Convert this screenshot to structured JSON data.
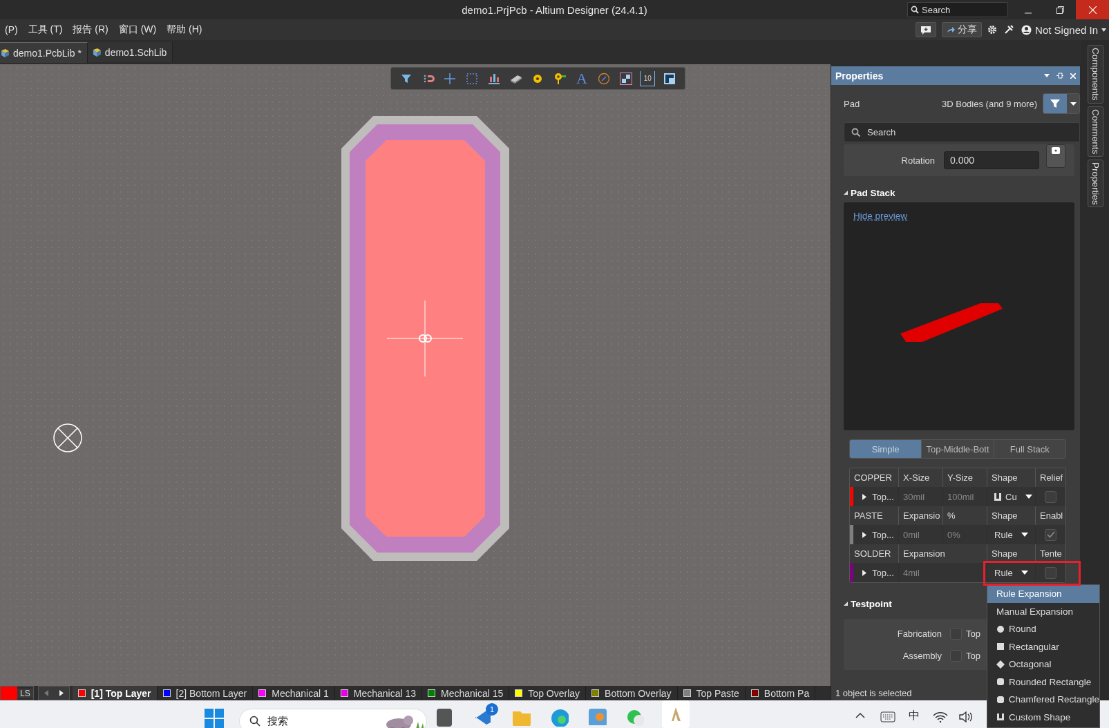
{
  "window": {
    "title": "demo1.PrjPcb - Altium Designer (24.4.1)",
    "search_placeholder": "Search"
  },
  "menu": [
    "(P)",
    "工具 (T)",
    "报告 (R)",
    "窗口 (W)",
    "帮助 (H)"
  ],
  "header_actions": {
    "share": "分享",
    "account": "Not Signed In"
  },
  "document_tabs": [
    {
      "label": "demo1.PcbLib *",
      "selected": true
    },
    {
      "label": "demo1.SchLib",
      "selected": false
    }
  ],
  "canvas_toolbar": [
    {
      "kind": "filter"
    },
    {
      "kind": "magnet"
    },
    {
      "kind": "cross"
    },
    {
      "kind": "select"
    },
    {
      "kind": "align"
    },
    {
      "kind": "chip"
    },
    {
      "kind": "pad"
    },
    {
      "kind": "via"
    },
    {
      "kind": "text",
      "glyph": "A"
    },
    {
      "kind": "arc"
    },
    {
      "kind": "fill"
    },
    {
      "kind": "port",
      "glyph": "10"
    },
    {
      "kind": "region"
    }
  ],
  "properties": {
    "title": "Properties",
    "object_type": "Pad",
    "filter_label": "3D Bodies (and 9 more)",
    "search_placeholder": "Search",
    "rotation": {
      "label": "Rotation",
      "value": "0.000"
    },
    "pad_stack": {
      "title": "Pad Stack",
      "preview_link": "Hide preview",
      "modes": [
        {
          "label": "Simple",
          "selected": true
        },
        {
          "label": "Top-Middle-Bott",
          "selected": false
        },
        {
          "label": "Full Stack",
          "selected": false
        }
      ],
      "groups": [
        {
          "columns": [
            "COPPER",
            "X-Size",
            "Y-Size",
            "Shape",
            "Relief"
          ],
          "row": {
            "layer": "Top...",
            "color": "#ff0000",
            "values": [
              "30mil",
              "100mil"
            ],
            "shape": "Cu",
            "kind": "custom",
            "checked": false,
            "highlighted": false
          }
        },
        {
          "columns": [
            "PASTE",
            "Expansio",
            "%",
            "Shape",
            "Enabl"
          ],
          "row": {
            "layer": "Top...",
            "color": "#808080",
            "values": [
              "0mil",
              "0%"
            ],
            "shape": "Rule",
            "kind": "rule",
            "checked": true,
            "highlighted": false
          }
        },
        {
          "columns": [
            "SOLDER",
            "Expansion",
            "Shape",
            "Tente"
          ],
          "row": {
            "layer": "Top...",
            "color": "#800080",
            "values": [
              "4mil"
            ],
            "shape": "Rule",
            "kind": "rule",
            "checked": false,
            "highlighted": true
          }
        }
      ]
    },
    "testpoint": {
      "title": "Testpoint",
      "items": [
        {
          "label": "Fabrication",
          "option": "Top",
          "checked": false
        },
        {
          "label": "Assembly",
          "option": "Top",
          "checked": false
        }
      ]
    },
    "status": "1 object is selected"
  },
  "side_tabs": [
    "Components",
    "Comments",
    "Properties"
  ],
  "layer_bar": {
    "mode": "LS",
    "layers": [
      {
        "name": "[1] Top Layer",
        "color": "#ff0000",
        "selected": true
      },
      {
        "name": "[2] Bottom Layer",
        "color": "#0000ff",
        "selected": false
      },
      {
        "name": "Mechanical 1",
        "color": "#ff00ff",
        "selected": false
      },
      {
        "name": "Mechanical 13",
        "color": "#e600e6",
        "selected": false
      },
      {
        "name": "Mechanical 15",
        "color": "#008000",
        "selected": false
      },
      {
        "name": "Top Overlay",
        "color": "#ffff00",
        "selected": false
      },
      {
        "name": "Bottom Overlay",
        "color": "#808000",
        "selected": false
      },
      {
        "name": "Top Paste",
        "color": "#808080",
        "selected": false
      },
      {
        "name": "Bottom Pa",
        "color": "#800000",
        "selected": false
      }
    ]
  },
  "shape_dropdown": [
    {
      "label": "Rule Expansion",
      "kind": "text",
      "selected": true
    },
    {
      "label": "Manual Expansion",
      "kind": "text",
      "selected": false
    },
    {
      "label": "Round",
      "kind": "round",
      "selected": false
    },
    {
      "label": "Rectangular",
      "kind": "rect",
      "selected": false
    },
    {
      "label": "Octagonal",
      "kind": "octagon",
      "selected": false
    },
    {
      "label": "Rounded Rectangle",
      "kind": "rounded",
      "selected": false
    },
    {
      "label": "Chamfered Rectangle",
      "kind": "chamfered",
      "selected": false
    },
    {
      "label": "Custom Shape",
      "kind": "custom",
      "selected": false
    }
  ],
  "taskbar": {
    "search_placeholder": "搜索",
    "badge": "1",
    "ime": "中"
  }
}
